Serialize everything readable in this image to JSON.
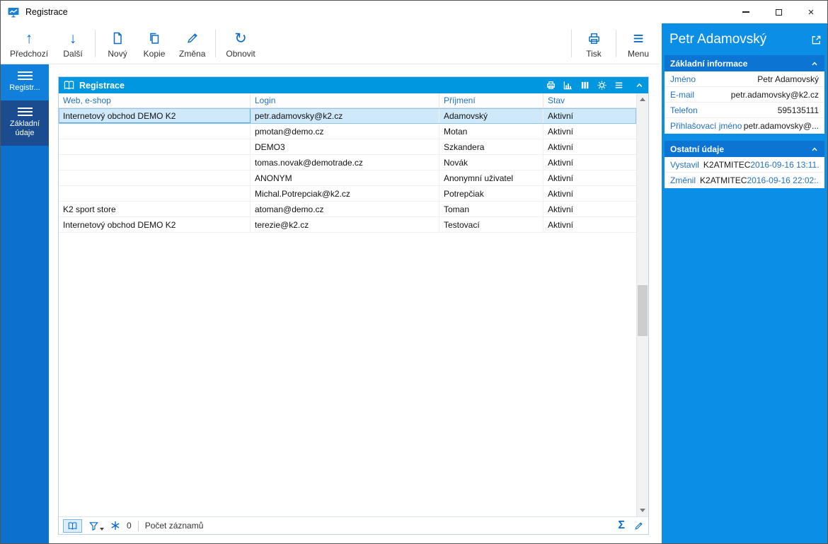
{
  "window": {
    "title": "Registrace"
  },
  "icons": {
    "arrow_up": "↑",
    "arrow_down": "↓",
    "refresh": "↻",
    "menu": "≡",
    "sigma": "Σ",
    "close": "×"
  },
  "toolbar": {
    "buttons": [
      {
        "label": "Předchozí"
      },
      {
        "label": "Další"
      },
      {
        "label": "Nový"
      },
      {
        "label": "Kopie"
      },
      {
        "label": "Změna"
      },
      {
        "label": "Obnovit"
      }
    ],
    "right_buttons": [
      {
        "label": "Tisk"
      },
      {
        "label": "Menu"
      }
    ]
  },
  "sidebar": {
    "items": [
      {
        "label": "Registr..."
      },
      {
        "label": "Základní údaje"
      }
    ]
  },
  "grid": {
    "title": "Registrace",
    "columns": [
      "Web, e-shop",
      "Login",
      "Příjmení",
      "Stav"
    ],
    "rows": [
      [
        "Internetový obchod DEMO K2",
        "petr.adamovsky@k2.cz",
        "Adamovský",
        "Aktivní"
      ],
      [
        "",
        "pmotan@demo.cz",
        "Motan",
        "Aktivní"
      ],
      [
        "",
        "DEMO3",
        "Szkandera",
        "Aktivní"
      ],
      [
        "",
        "tomas.novak@demotrade.cz",
        "Novák",
        "Aktivní"
      ],
      [
        "",
        "ANONYM",
        "Anonymní uživatel",
        "Aktivní"
      ],
      [
        "",
        "Michal.Potrepciak@k2.cz",
        "Potrepčiak",
        "Aktivní"
      ],
      [
        "K2 sport store",
        "atoman@demo.cz",
        "Toman",
        "Aktivní"
      ],
      [
        "Internetový obchod DEMO K2",
        "terezie@k2.cz",
        "Testovací",
        "Aktivní"
      ]
    ],
    "selected_row_index": 0,
    "status": {
      "count_badge": "0",
      "records_label": "Počet záznamů"
    }
  },
  "detail": {
    "title": "Petr Adamovský",
    "sections": [
      {
        "title": "Základní informace",
        "fields": [
          {
            "label": "Jméno",
            "value": "Petr Adamovský"
          },
          {
            "label": "E-mail",
            "value": "petr.adamovsky@k2.cz"
          },
          {
            "label": "Telefon",
            "value": "595135111"
          },
          {
            "label": "Přihlašovací jméno",
            "value": "petr.adamovsky@..."
          }
        ]
      },
      {
        "title": "Ostatní údaje",
        "fields": [
          {
            "label": "Vystavil",
            "value": "K2ATMITEC",
            "extra": "2016-09-16 13:11..."
          },
          {
            "label": "Změnil",
            "value": "K2ATMITEC",
            "extra": "2016-09-16 22:02:..."
          }
        ]
      }
    ]
  },
  "colors": {
    "accent_blue": "#0b6cc8",
    "label_blue": "#2272c4",
    "grid_titlebar": "#0096e0",
    "panel_bg": "#0a8ee6",
    "section_header_bg": "#0c74d2",
    "sidebar_bg": "#0c71ce",
    "sidebar_item_secondary_bg": "#1a4c8f",
    "selected_row_bg": "#cfe9fb"
  }
}
